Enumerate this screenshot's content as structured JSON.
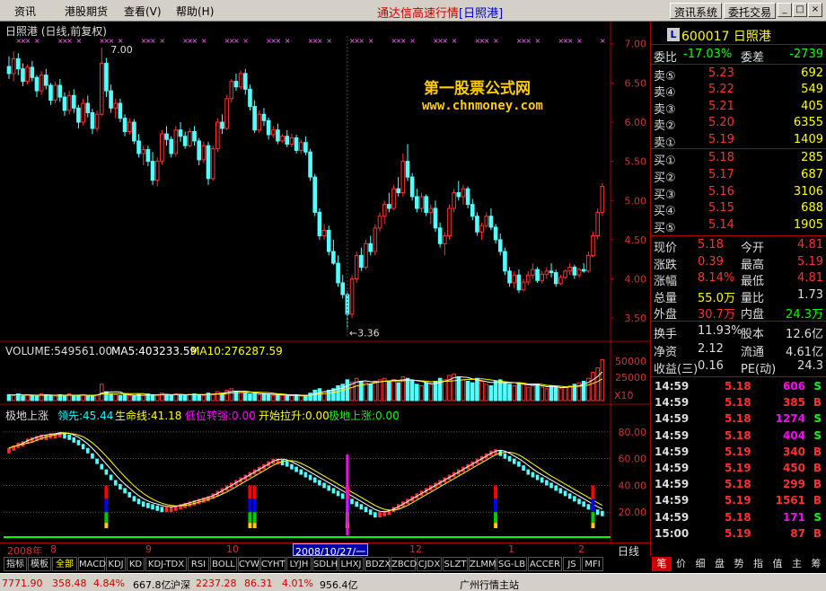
{
  "menu": {
    "items": [
      "资讯",
      "港股期货",
      "查看(V)",
      "帮助(H)"
    ]
  },
  "title": {
    "app": "通达信高速行情",
    "stock": "[日照港]"
  },
  "toolbar": {
    "btn1": "资讯系统",
    "btn2": "委托交易"
  },
  "window_buttons": {
    "minimize": "_",
    "maximize": "□",
    "close": "×"
  },
  "chart": {
    "title": "日照港 (日线,前复权)",
    "price_axis": [
      "7.00",
      "6.50",
      "6.00",
      "5.50",
      "5.00",
      "4.50",
      "4.00",
      "3.50"
    ],
    "price_range": [
      3.25,
      7.1
    ],
    "high_label": "7.00",
    "low_label": "←3.36",
    "watermark1": "第一股票公式网",
    "watermark2": "www.chnmoney.com",
    "candles": [
      [
        6.71,
        6.84,
        6.55,
        6.62
      ],
      [
        6.62,
        6.9,
        6.52,
        6.81
      ],
      [
        6.81,
        6.88,
        6.6,
        6.68
      ],
      [
        6.68,
        6.75,
        6.46,
        6.52
      ],
      [
        6.52,
        6.74,
        6.48,
        6.7
      ],
      [
        6.7,
        6.78,
        6.52,
        6.57
      ],
      [
        6.57,
        6.6,
        6.32,
        6.4
      ],
      [
        6.4,
        6.65,
        6.35,
        6.6
      ],
      [
        6.6,
        6.68,
        6.42,
        6.47
      ],
      [
        6.47,
        6.5,
        6.22,
        6.28
      ],
      [
        6.28,
        6.52,
        6.24,
        6.47
      ],
      [
        6.47,
        6.55,
        6.26,
        6.32
      ],
      [
        6.32,
        6.38,
        6.08,
        6.15
      ],
      [
        6.15,
        6.4,
        6.1,
        6.34
      ],
      [
        6.34,
        6.42,
        6.12,
        6.18
      ],
      [
        6.18,
        6.22,
        5.92,
        6.0
      ],
      [
        6.0,
        6.3,
        5.96,
        6.24
      ],
      [
        6.24,
        6.34,
        6.06,
        6.12
      ],
      [
        6.12,
        6.17,
        5.85,
        5.92
      ],
      [
        5.92,
        6.15,
        5.88,
        6.1
      ],
      [
        6.1,
        6.95,
        6.08,
        6.75
      ],
      [
        6.75,
        6.82,
        6.32,
        6.4
      ],
      [
        6.4,
        6.48,
        6.12,
        6.18
      ],
      [
        6.18,
        6.3,
        6.05,
        6.24
      ],
      [
        6.24,
        6.3,
        6.0,
        6.05
      ],
      [
        6.05,
        6.1,
        5.82,
        5.88
      ],
      [
        5.88,
        6.05,
        5.84,
        6.0
      ],
      [
        6.0,
        6.04,
        5.72,
        5.76
      ],
      [
        5.76,
        5.85,
        5.55,
        5.6
      ],
      [
        5.6,
        5.7,
        5.45,
        5.65
      ],
      [
        5.65,
        5.7,
        5.44,
        5.5
      ],
      [
        5.5,
        5.62,
        5.2,
        5.26
      ],
      [
        5.26,
        5.55,
        5.18,
        5.5
      ],
      [
        5.5,
        5.9,
        5.46,
        5.85
      ],
      [
        5.85,
        5.95,
        5.7,
        5.78
      ],
      [
        5.78,
        5.82,
        5.55,
        5.6
      ],
      [
        5.6,
        5.95,
        5.56,
        5.9
      ],
      [
        5.9,
        6.0,
        5.75,
        5.82
      ],
      [
        5.82,
        5.88,
        5.66,
        5.7
      ],
      [
        5.7,
        5.92,
        5.68,
        5.88
      ],
      [
        5.88,
        5.95,
        5.7,
        5.76
      ],
      [
        5.76,
        5.8,
        5.45,
        5.52
      ],
      [
        5.52,
        5.75,
        5.48,
        5.7
      ],
      [
        5.7,
        5.75,
        5.2,
        5.28
      ],
      [
        5.28,
        5.7,
        5.25,
        5.66
      ],
      [
        5.66,
        6.05,
        5.62,
        6.0
      ],
      [
        6.0,
        6.1,
        5.85,
        5.92
      ],
      [
        5.92,
        6.35,
        5.9,
        6.3
      ],
      [
        6.3,
        6.55,
        6.25,
        6.52
      ],
      [
        6.52,
        6.62,
        6.4,
        6.45
      ],
      [
        6.45,
        6.66,
        6.42,
        6.62
      ],
      [
        6.62,
        6.68,
        6.35,
        6.42
      ],
      [
        6.42,
        6.48,
        6.15,
        6.2
      ],
      [
        6.2,
        6.28,
        5.86,
        5.9
      ],
      [
        5.9,
        6.15,
        5.86,
        6.1
      ],
      [
        6.1,
        6.18,
        5.95,
        6.02
      ],
      [
        6.02,
        6.06,
        5.78,
        5.84
      ],
      [
        5.84,
        5.95,
        5.8,
        5.9
      ],
      [
        5.9,
        5.98,
        5.72,
        5.76
      ],
      [
        5.76,
        5.85,
        5.74,
        5.82
      ],
      [
        5.82,
        5.9,
        5.68,
        5.72
      ],
      [
        5.72,
        5.85,
        5.68,
        5.8
      ],
      [
        5.8,
        5.84,
        5.6,
        5.64
      ],
      [
        5.64,
        5.78,
        5.6,
        5.74
      ],
      [
        5.74,
        5.82,
        5.58,
        5.62
      ],
      [
        5.62,
        5.66,
        5.25,
        5.3
      ],
      [
        5.3,
        5.34,
        4.8,
        4.85
      ],
      [
        4.85,
        4.9,
        4.5,
        4.55
      ],
      [
        4.55,
        4.7,
        4.5,
        4.62
      ],
      [
        4.62,
        4.68,
        4.3,
        4.35
      ],
      [
        4.35,
        4.5,
        4.18,
        4.2
      ],
      [
        4.2,
        4.3,
        3.9,
        3.95
      ],
      [
        3.95,
        4.05,
        3.75,
        3.8
      ],
      [
        3.8,
        3.85,
        3.36,
        3.55
      ],
      [
        3.55,
        4.05,
        3.5,
        4.0
      ],
      [
        4.0,
        4.35,
        3.95,
        4.3
      ],
      [
        4.3,
        4.4,
        4.1,
        4.15
      ],
      [
        4.15,
        4.5,
        4.12,
        4.45
      ],
      [
        4.45,
        4.55,
        4.3,
        4.35
      ],
      [
        4.35,
        4.7,
        4.3,
        4.65
      ],
      [
        4.65,
        4.85,
        4.6,
        4.8
      ],
      [
        4.8,
        5.0,
        4.7,
        4.95
      ],
      [
        4.95,
        5.1,
        4.85,
        4.9
      ],
      [
        4.9,
        5.2,
        4.88,
        5.15
      ],
      [
        5.15,
        5.3,
        5.05,
        5.1
      ],
      [
        5.1,
        5.6,
        5.05,
        5.5
      ],
      [
        5.5,
        5.72,
        5.25,
        5.3
      ],
      [
        5.3,
        5.35,
        5.0,
        5.05
      ],
      [
        5.05,
        5.15,
        4.85,
        4.9
      ],
      [
        4.9,
        5.1,
        4.85,
        5.05
      ],
      [
        5.05,
        5.08,
        4.8,
        4.85
      ],
      [
        4.85,
        4.95,
        4.7,
        4.9
      ],
      [
        4.9,
        5.0,
        4.6,
        4.65
      ],
      [
        4.65,
        4.72,
        4.4,
        4.45
      ],
      [
        4.45,
        4.6,
        4.3,
        4.55
      ],
      [
        4.55,
        4.95,
        4.5,
        4.9
      ],
      [
        4.9,
        5.15,
        4.85,
        5.1
      ],
      [
        5.1,
        5.25,
        5.0,
        5.05
      ],
      [
        5.05,
        5.2,
        4.95,
        5.15
      ],
      [
        5.15,
        5.18,
        4.9,
        4.95
      ],
      [
        4.95,
        5.02,
        4.75,
        4.8
      ],
      [
        4.8,
        4.85,
        4.55,
        4.6
      ],
      [
        4.6,
        4.72,
        4.5,
        4.68
      ],
      [
        4.68,
        4.85,
        4.65,
        4.8
      ],
      [
        4.8,
        4.9,
        4.62,
        4.66
      ],
      [
        4.66,
        4.7,
        4.45,
        4.5
      ],
      [
        4.5,
        4.58,
        4.3,
        4.35
      ],
      [
        4.35,
        4.4,
        4.05,
        4.1
      ],
      [
        4.1,
        4.15,
        3.9,
        3.95
      ],
      [
        3.95,
        4.1,
        3.88,
        4.05
      ],
      [
        4.05,
        4.12,
        3.82,
        3.86
      ],
      [
        3.86,
        4.0,
        3.84,
        3.96
      ],
      [
        3.96,
        4.1,
        3.92,
        4.05
      ],
      [
        4.05,
        4.2,
        4.0,
        4.12
      ],
      [
        4.12,
        4.15,
        3.95,
        3.98
      ],
      [
        3.98,
        4.1,
        3.94,
        4.06
      ],
      [
        4.06,
        4.15,
        4.0,
        4.1
      ],
      [
        4.1,
        4.2,
        4.02,
        4.08
      ],
      [
        4.08,
        4.12,
        3.9,
        3.94
      ],
      [
        3.94,
        4.05,
        3.92,
        4.02
      ],
      [
        4.02,
        4.12,
        4.0,
        4.1
      ],
      [
        4.1,
        4.2,
        4.05,
        4.15
      ],
      [
        4.15,
        4.18,
        4.0,
        4.05
      ],
      [
        4.05,
        4.14,
        4.02,
        4.12
      ],
      [
        4.12,
        4.2,
        4.08,
        4.1
      ],
      [
        4.1,
        4.35,
        4.08,
        4.3
      ],
      [
        4.3,
        4.6,
        4.28,
        4.55
      ],
      [
        4.55,
        4.9,
        4.5,
        4.85
      ],
      [
        4.85,
        5.22,
        4.8,
        5.18
      ]
    ],
    "volume_title": {
      "main": "VOLUME:549561.00",
      "ma5": "MA5:403233.59",
      "ma10": "MA10:276287.59"
    },
    "volume_axis": [
      "50000",
      "25000"
    ],
    "volume_unit": "X10",
    "volumes": [
      8,
      7,
      9,
      6,
      8,
      7,
      6,
      9,
      8,
      7,
      6,
      8,
      7,
      9,
      6,
      7,
      8,
      6,
      7,
      8,
      22,
      12,
      9,
      8,
      7,
      8,
      7,
      6,
      8,
      7,
      9,
      8,
      7,
      10,
      8,
      7,
      9,
      8,
      7,
      8,
      9,
      8,
      7,
      10,
      9,
      12,
      10,
      14,
      16,
      12,
      11,
      10,
      9,
      10,
      8,
      9,
      8,
      7,
      8,
      7,
      6,
      7,
      8,
      6,
      7,
      10,
      14,
      16,
      12,
      14,
      16,
      20,
      22,
      28,
      25,
      30,
      26,
      24,
      22,
      26,
      28,
      30,
      26,
      28,
      24,
      32,
      30,
      26,
      22,
      20,
      24,
      22,
      26,
      30,
      28,
      34,
      36,
      32,
      28,
      26,
      24,
      30,
      26,
      22,
      20,
      26,
      28,
      24,
      22,
      20,
      24,
      22,
      18,
      20,
      22,
      18,
      16,
      20,
      18,
      16,
      18,
      20,
      22,
      24,
      26,
      30,
      38,
      44,
      55
    ],
    "indicator_title": {
      "name": "极地上涨",
      "lead": "领先:45.44",
      "life": "生命线:41.18",
      "low": "低位转强:0.00",
      "start": "开始拉升:0.00",
      "polar": "极地上涨:0.00"
    },
    "indicator_axis": [
      "80.00",
      "60.00",
      "40.00",
      "20.00"
    ],
    "indicator_range": [
      0,
      90
    ],
    "indicator": [
      68,
      70,
      72,
      73,
      75,
      76,
      77,
      78,
      78,
      79,
      79,
      80,
      79,
      78,
      76,
      74,
      71,
      68,
      64,
      60,
      56,
      52,
      48,
      44,
      41,
      38,
      35,
      32,
      30,
      28,
      27,
      26,
      25,
      24,
      24,
      24,
      25,
      26,
      27,
      28,
      29,
      30,
      31,
      32,
      34,
      36,
      38,
      40,
      42,
      44,
      46,
      48,
      50,
      52,
      54,
      56,
      58,
      60,
      60,
      59,
      58,
      56,
      54,
      52,
      50,
      48,
      46,
      44,
      42,
      40,
      38,
      36,
      34,
      32,
      30,
      28,
      26,
      24,
      22,
      20,
      20,
      21,
      22,
      24,
      26,
      28,
      30,
      32,
      34,
      36,
      38,
      40,
      42,
      44,
      46,
      48,
      50,
      52,
      54,
      56,
      58,
      60,
      62,
      64,
      66,
      67,
      66,
      64,
      62,
      60,
      58,
      55,
      52,
      50,
      48,
      46,
      44,
      42,
      40,
      38,
      36,
      34,
      32,
      30,
      28,
      26,
      24,
      22,
      21,
      20,
      20,
      20,
      21,
      22,
      24,
      26,
      28,
      30,
      32,
      34,
      36,
      38,
      40,
      44,
      50,
      60
    ],
    "signal_bars": [
      21,
      52,
      53,
      73,
      105,
      126,
      131,
      133
    ]
  },
  "dates": {
    "labels": [
      "2008年",
      "8",
      "9",
      "10",
      "11",
      "12",
      "1",
      "2"
    ],
    "cursor": "2008/10/27/一",
    "period": "日线"
  },
  "tabs": [
    "指标",
    "模板",
    "全部",
    "MACD",
    "KDJ",
    "KD",
    "KDJ-TDX",
    "RSI",
    "BOLL",
    "CYW",
    "CYHT",
    "LYJH",
    "SDLH",
    "LHXJ",
    "BDZX",
    "ZBCD",
    "CJDX",
    "SLZT",
    "ZLMM",
    "SG-LB",
    "ACCER",
    "JS",
    "MFI"
  ],
  "quote": {
    "badge": "L",
    "code": "600017",
    "name": "日照港",
    "weibi_label": "委比",
    "weibi": "-17.03%",
    "weicha_label": "委差",
    "weicha": "-2739",
    "sells": [
      [
        "卖⑤",
        "5.23",
        "692"
      ],
      [
        "卖④",
        "5.22",
        "549"
      ],
      [
        "卖③",
        "5.21",
        "405"
      ],
      [
        "卖②",
        "5.20",
        "6355"
      ],
      [
        "卖①",
        "5.19",
        "1409"
      ]
    ],
    "buys": [
      [
        "买①",
        "5.18",
        "285"
      ],
      [
        "买②",
        "5.17",
        "687"
      ],
      [
        "买③",
        "5.16",
        "3106"
      ],
      [
        "买④",
        "5.15",
        "688"
      ],
      [
        "买⑤",
        "5.14",
        "1905"
      ]
    ],
    "stats": [
      [
        "现价",
        "5.18",
        "今开",
        "4.81"
      ],
      [
        "涨跌",
        "0.39",
        "最高",
        "5.19"
      ],
      [
        "涨幅",
        "8.14%",
        "最低",
        "4.81"
      ],
      [
        "总量",
        "55.0万",
        "量比",
        "1.73"
      ],
      [
        "外盘",
        "30.7万",
        "内盘",
        "24.3万"
      ]
    ],
    "stats2": [
      [
        "换手",
        "11.93%",
        "股本",
        "12.6亿"
      ],
      [
        "净资",
        "2.12",
        "流通",
        "4.61亿"
      ],
      [
        "收益(三)",
        "0.16",
        "PE(动)",
        "24.3"
      ]
    ],
    "trades": [
      [
        "14:59",
        "5.18",
        "606",
        "S"
      ],
      [
        "14:59",
        "5.18",
        "385",
        "B"
      ],
      [
        "14:59",
        "5.18",
        "1274",
        "S"
      ],
      [
        "14:59",
        "5.18",
        "404",
        "S"
      ],
      [
        "14:59",
        "5.19",
        "340",
        "B"
      ],
      [
        "14:59",
        "5.19",
        "450",
        "B"
      ],
      [
        "14:59",
        "5.18",
        "299",
        "B"
      ],
      [
        "14:59",
        "5.19",
        "1561",
        "B"
      ],
      [
        "14:59",
        "5.18",
        "171",
        "S"
      ],
      [
        "15:00",
        "5.19",
        "87",
        "B"
      ]
    ]
  },
  "right_tabs": [
    "笔",
    "价",
    "细",
    "盘",
    "势",
    "指",
    "值",
    "主",
    "筹"
  ],
  "status": {
    "idx1": "7771.90",
    "chg1": "358.48",
    "pct1": "4.84%",
    "amt1": "667.8亿",
    "name2": "沪深",
    "idx2": "2237.28",
    "chg2": "86.31",
    "pct2": "4.01%",
    "amt2": "956.4亿",
    "station": "广州行情主站"
  },
  "colors": {
    "up": "#ff3030",
    "down": "#54ffff",
    "axis": "#aa0000",
    "ma5": "#ffffff",
    "ma10": "#ffff00"
  }
}
